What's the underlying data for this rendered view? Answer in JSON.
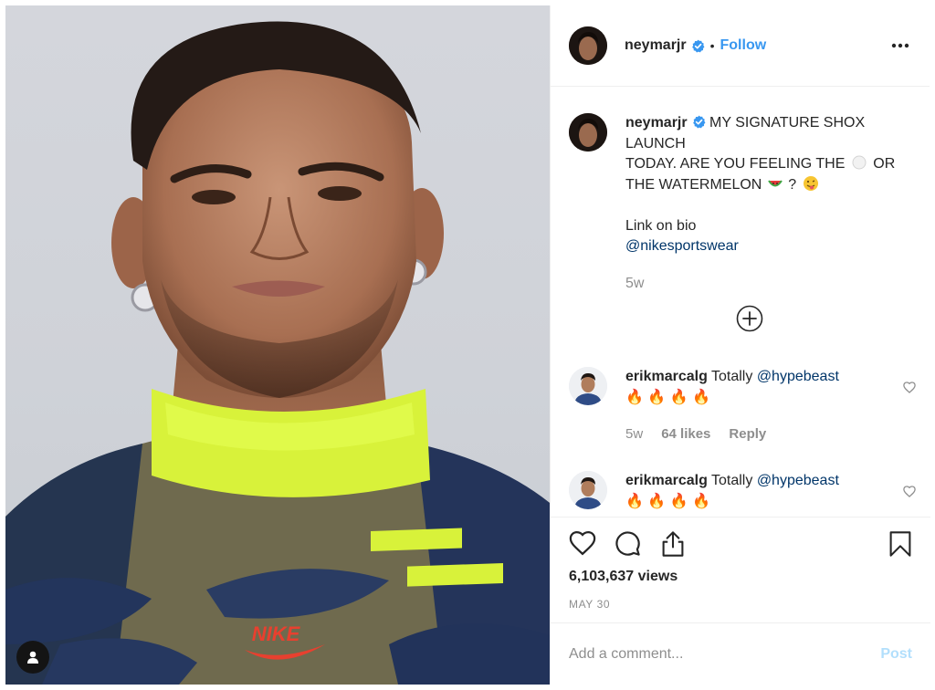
{
  "post": {
    "username": "neymarjr",
    "follow_label": "Follow",
    "separator": "•",
    "caption_lines": [
      "MY SIGNATURE SHOX",
      "LAUNCH",
      "TODAY. ARE YOU FEELING THE",
      "OR",
      "THE WATERMELON",
      "?",
      "Link on bio"
    ],
    "caption_mention": "@nikesportswear",
    "caption_time": "5w",
    "views": "6,103,637 views",
    "date": "MAY 30",
    "brand_mark": "NIKE"
  },
  "comments": [
    {
      "username": "erikmarcalg",
      "text": "Totally",
      "mention": "@hypebeast",
      "emojis": "🔥 🔥 🔥 🔥",
      "time": "5w",
      "likes": "64 likes",
      "reply_label": "Reply"
    },
    {
      "username": "erikmarcalg",
      "text": "Totally",
      "mention": "@hypebeast",
      "emojis": "🔥 🔥 🔥 🔥"
    }
  ],
  "composer": {
    "placeholder": "Add a comment...",
    "post_label": "Post"
  },
  "colors": {
    "accent": "#3897f0",
    "mention": "#003569",
    "muted": "#8e8e8e",
    "post_disabled": "#b2dffc",
    "neon": "#d8f23a"
  },
  "icons": [
    "verified-icon",
    "more-options-icon",
    "load-more-icon",
    "heart-icon",
    "comment-icon",
    "share-icon",
    "bookmark-icon",
    "user-tag-icon"
  ]
}
